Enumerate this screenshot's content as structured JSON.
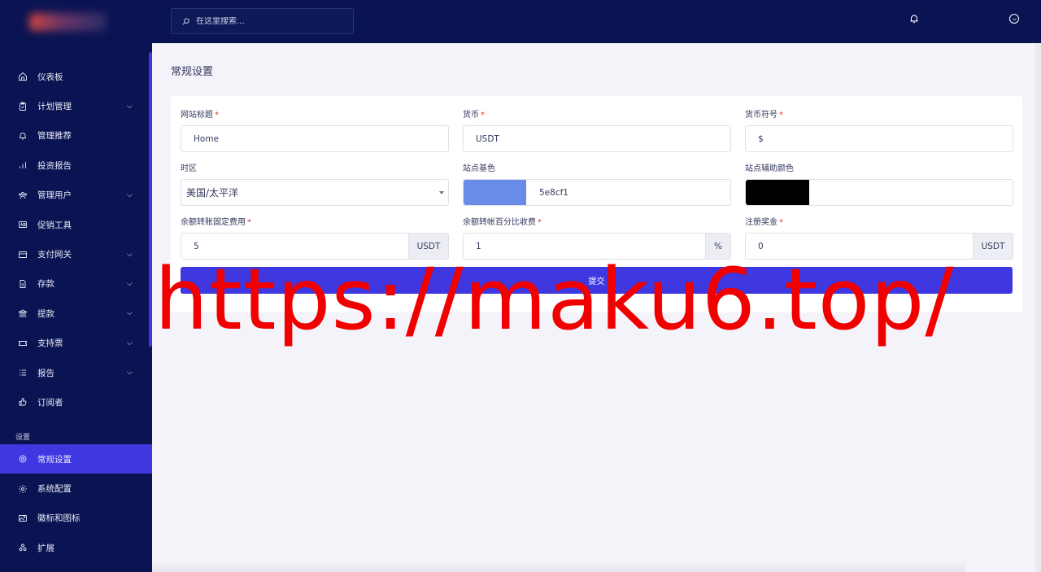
{
  "search": {
    "placeholder": "在这里搜索..."
  },
  "sidebar": {
    "items": [
      {
        "label": "仪表板",
        "icon": "home-icon",
        "has_chevron": false
      },
      {
        "label": "计划管理",
        "icon": "clipboard-icon",
        "has_chevron": true
      },
      {
        "label": "管理推荐",
        "icon": "bell-icon",
        "has_chevron": false
      },
      {
        "label": "投资报告",
        "icon": "bar-chart-icon",
        "has_chevron": false
      },
      {
        "label": "管理用户",
        "icon": "users-icon",
        "has_chevron": true
      },
      {
        "label": "促销工具",
        "icon": "ad-icon",
        "has_chevron": false
      },
      {
        "label": "支付网关",
        "icon": "credit-card-icon",
        "has_chevron": true
      },
      {
        "label": "存款",
        "icon": "file-invoice-icon",
        "has_chevron": true
      },
      {
        "label": "提款",
        "icon": "bank-icon",
        "has_chevron": true
      },
      {
        "label": "支持票",
        "icon": "ticket-icon",
        "has_chevron": true
      },
      {
        "label": "报告",
        "icon": "list-icon",
        "has_chevron": true
      },
      {
        "label": "订阅者",
        "icon": "thumbs-up-icon",
        "has_chevron": false
      }
    ],
    "section_title": "设置",
    "settings_items": [
      {
        "label": "常规设置",
        "icon": "life-ring-icon",
        "active": true
      },
      {
        "label": "系统配置",
        "icon": "gear-icon",
        "active": false
      },
      {
        "label": "徽标和图标",
        "icon": "image-icon",
        "active": false
      },
      {
        "label": "扩展",
        "icon": "puzzle-icon",
        "active": false
      }
    ]
  },
  "page": {
    "title": "常规设置"
  },
  "form": {
    "site_title": {
      "label": "网站标题",
      "required": "*",
      "value": "Home"
    },
    "currency": {
      "label": "货币",
      "required": "*",
      "value": "USDT"
    },
    "currency_symbol": {
      "label": "货币符号",
      "required": "*",
      "value": "$"
    },
    "timezone": {
      "label": "时区",
      "value": "美国/太平洋"
    },
    "base_color": {
      "label": "站点基色",
      "value": "5e8cf1",
      "swatch": "#6a8ce8"
    },
    "secondary_color": {
      "label": "站点辅助颜色",
      "value": "",
      "swatch": "#000000"
    },
    "fixed_fee": {
      "label": "余额转账固定费用",
      "required": "*",
      "value": "5",
      "addon": "USDT"
    },
    "percent_fee": {
      "label": "余额转帐百分比收费",
      "required": "*",
      "value": "1",
      "addon": "%"
    },
    "signup_bonus": {
      "label": "注册奖金",
      "required": "*",
      "value": "0",
      "addon": "USDT"
    },
    "submit_label": "提交"
  },
  "watermark": "https://maku6.top/",
  "colors": {
    "sidebar": "#0b1452",
    "accent": "#3f37e0",
    "watermark": "#f10000"
  }
}
